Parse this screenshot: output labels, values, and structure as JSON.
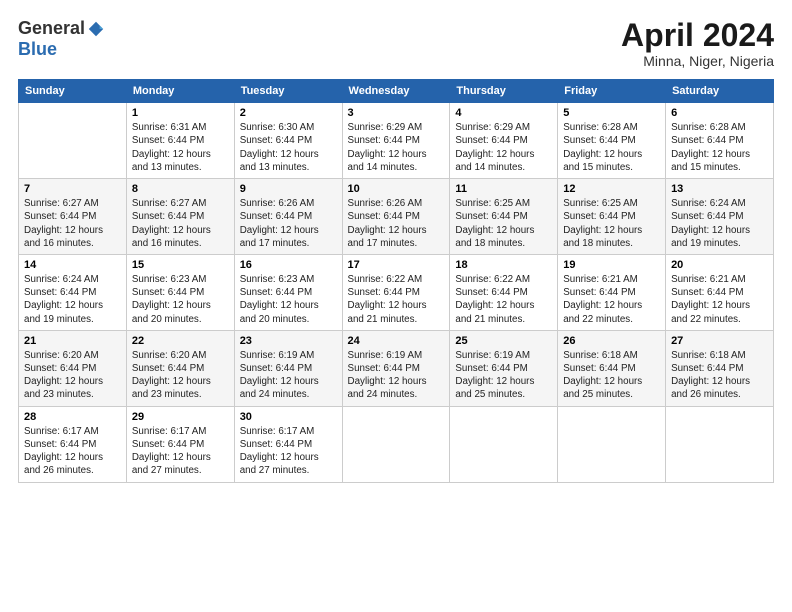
{
  "header": {
    "logo_general": "General",
    "logo_blue": "Blue",
    "title": "April 2024",
    "location": "Minna, Niger, Nigeria"
  },
  "days_of_week": [
    "Sunday",
    "Monday",
    "Tuesday",
    "Wednesday",
    "Thursday",
    "Friday",
    "Saturday"
  ],
  "weeks": [
    [
      {
        "day": "",
        "sunrise": "",
        "sunset": "",
        "daylight": ""
      },
      {
        "day": "1",
        "sunrise": "Sunrise: 6:31 AM",
        "sunset": "Sunset: 6:44 PM",
        "daylight": "Daylight: 12 hours and 13 minutes."
      },
      {
        "day": "2",
        "sunrise": "Sunrise: 6:30 AM",
        "sunset": "Sunset: 6:44 PM",
        "daylight": "Daylight: 12 hours and 13 minutes."
      },
      {
        "day": "3",
        "sunrise": "Sunrise: 6:29 AM",
        "sunset": "Sunset: 6:44 PM",
        "daylight": "Daylight: 12 hours and 14 minutes."
      },
      {
        "day": "4",
        "sunrise": "Sunrise: 6:29 AM",
        "sunset": "Sunset: 6:44 PM",
        "daylight": "Daylight: 12 hours and 14 minutes."
      },
      {
        "day": "5",
        "sunrise": "Sunrise: 6:28 AM",
        "sunset": "Sunset: 6:44 PM",
        "daylight": "Daylight: 12 hours and 15 minutes."
      },
      {
        "day": "6",
        "sunrise": "Sunrise: 6:28 AM",
        "sunset": "Sunset: 6:44 PM",
        "daylight": "Daylight: 12 hours and 15 minutes."
      }
    ],
    [
      {
        "day": "7",
        "sunrise": "Sunrise: 6:27 AM",
        "sunset": "Sunset: 6:44 PM",
        "daylight": "Daylight: 12 hours and 16 minutes."
      },
      {
        "day": "8",
        "sunrise": "Sunrise: 6:27 AM",
        "sunset": "Sunset: 6:44 PM",
        "daylight": "Daylight: 12 hours and 16 minutes."
      },
      {
        "day": "9",
        "sunrise": "Sunrise: 6:26 AM",
        "sunset": "Sunset: 6:44 PM",
        "daylight": "Daylight: 12 hours and 17 minutes."
      },
      {
        "day": "10",
        "sunrise": "Sunrise: 6:26 AM",
        "sunset": "Sunset: 6:44 PM",
        "daylight": "Daylight: 12 hours and 17 minutes."
      },
      {
        "day": "11",
        "sunrise": "Sunrise: 6:25 AM",
        "sunset": "Sunset: 6:44 PM",
        "daylight": "Daylight: 12 hours and 18 minutes."
      },
      {
        "day": "12",
        "sunrise": "Sunrise: 6:25 AM",
        "sunset": "Sunset: 6:44 PM",
        "daylight": "Daylight: 12 hours and 18 minutes."
      },
      {
        "day": "13",
        "sunrise": "Sunrise: 6:24 AM",
        "sunset": "Sunset: 6:44 PM",
        "daylight": "Daylight: 12 hours and 19 minutes."
      }
    ],
    [
      {
        "day": "14",
        "sunrise": "Sunrise: 6:24 AM",
        "sunset": "Sunset: 6:44 PM",
        "daylight": "Daylight: 12 hours and 19 minutes."
      },
      {
        "day": "15",
        "sunrise": "Sunrise: 6:23 AM",
        "sunset": "Sunset: 6:44 PM",
        "daylight": "Daylight: 12 hours and 20 minutes."
      },
      {
        "day": "16",
        "sunrise": "Sunrise: 6:23 AM",
        "sunset": "Sunset: 6:44 PM",
        "daylight": "Daylight: 12 hours and 20 minutes."
      },
      {
        "day": "17",
        "sunrise": "Sunrise: 6:22 AM",
        "sunset": "Sunset: 6:44 PM",
        "daylight": "Daylight: 12 hours and 21 minutes."
      },
      {
        "day": "18",
        "sunrise": "Sunrise: 6:22 AM",
        "sunset": "Sunset: 6:44 PM",
        "daylight": "Daylight: 12 hours and 21 minutes."
      },
      {
        "day": "19",
        "sunrise": "Sunrise: 6:21 AM",
        "sunset": "Sunset: 6:44 PM",
        "daylight": "Daylight: 12 hours and 22 minutes."
      },
      {
        "day": "20",
        "sunrise": "Sunrise: 6:21 AM",
        "sunset": "Sunset: 6:44 PM",
        "daylight": "Daylight: 12 hours and 22 minutes."
      }
    ],
    [
      {
        "day": "21",
        "sunrise": "Sunrise: 6:20 AM",
        "sunset": "Sunset: 6:44 PM",
        "daylight": "Daylight: 12 hours and 23 minutes."
      },
      {
        "day": "22",
        "sunrise": "Sunrise: 6:20 AM",
        "sunset": "Sunset: 6:44 PM",
        "daylight": "Daylight: 12 hours and 23 minutes."
      },
      {
        "day": "23",
        "sunrise": "Sunrise: 6:19 AM",
        "sunset": "Sunset: 6:44 PM",
        "daylight": "Daylight: 12 hours and 24 minutes."
      },
      {
        "day": "24",
        "sunrise": "Sunrise: 6:19 AM",
        "sunset": "Sunset: 6:44 PM",
        "daylight": "Daylight: 12 hours and 24 minutes."
      },
      {
        "day": "25",
        "sunrise": "Sunrise: 6:19 AM",
        "sunset": "Sunset: 6:44 PM",
        "daylight": "Daylight: 12 hours and 25 minutes."
      },
      {
        "day": "26",
        "sunrise": "Sunrise: 6:18 AM",
        "sunset": "Sunset: 6:44 PM",
        "daylight": "Daylight: 12 hours and 25 minutes."
      },
      {
        "day": "27",
        "sunrise": "Sunrise: 6:18 AM",
        "sunset": "Sunset: 6:44 PM",
        "daylight": "Daylight: 12 hours and 26 minutes."
      }
    ],
    [
      {
        "day": "28",
        "sunrise": "Sunrise: 6:17 AM",
        "sunset": "Sunset: 6:44 PM",
        "daylight": "Daylight: 12 hours and 26 minutes."
      },
      {
        "day": "29",
        "sunrise": "Sunrise: 6:17 AM",
        "sunset": "Sunset: 6:44 PM",
        "daylight": "Daylight: 12 hours and 27 minutes."
      },
      {
        "day": "30",
        "sunrise": "Sunrise: 6:17 AM",
        "sunset": "Sunset: 6:44 PM",
        "daylight": "Daylight: 12 hours and 27 minutes."
      },
      {
        "day": "",
        "sunrise": "",
        "sunset": "",
        "daylight": ""
      },
      {
        "day": "",
        "sunrise": "",
        "sunset": "",
        "daylight": ""
      },
      {
        "day": "",
        "sunrise": "",
        "sunset": "",
        "daylight": ""
      },
      {
        "day": "",
        "sunrise": "",
        "sunset": "",
        "daylight": ""
      }
    ]
  ]
}
